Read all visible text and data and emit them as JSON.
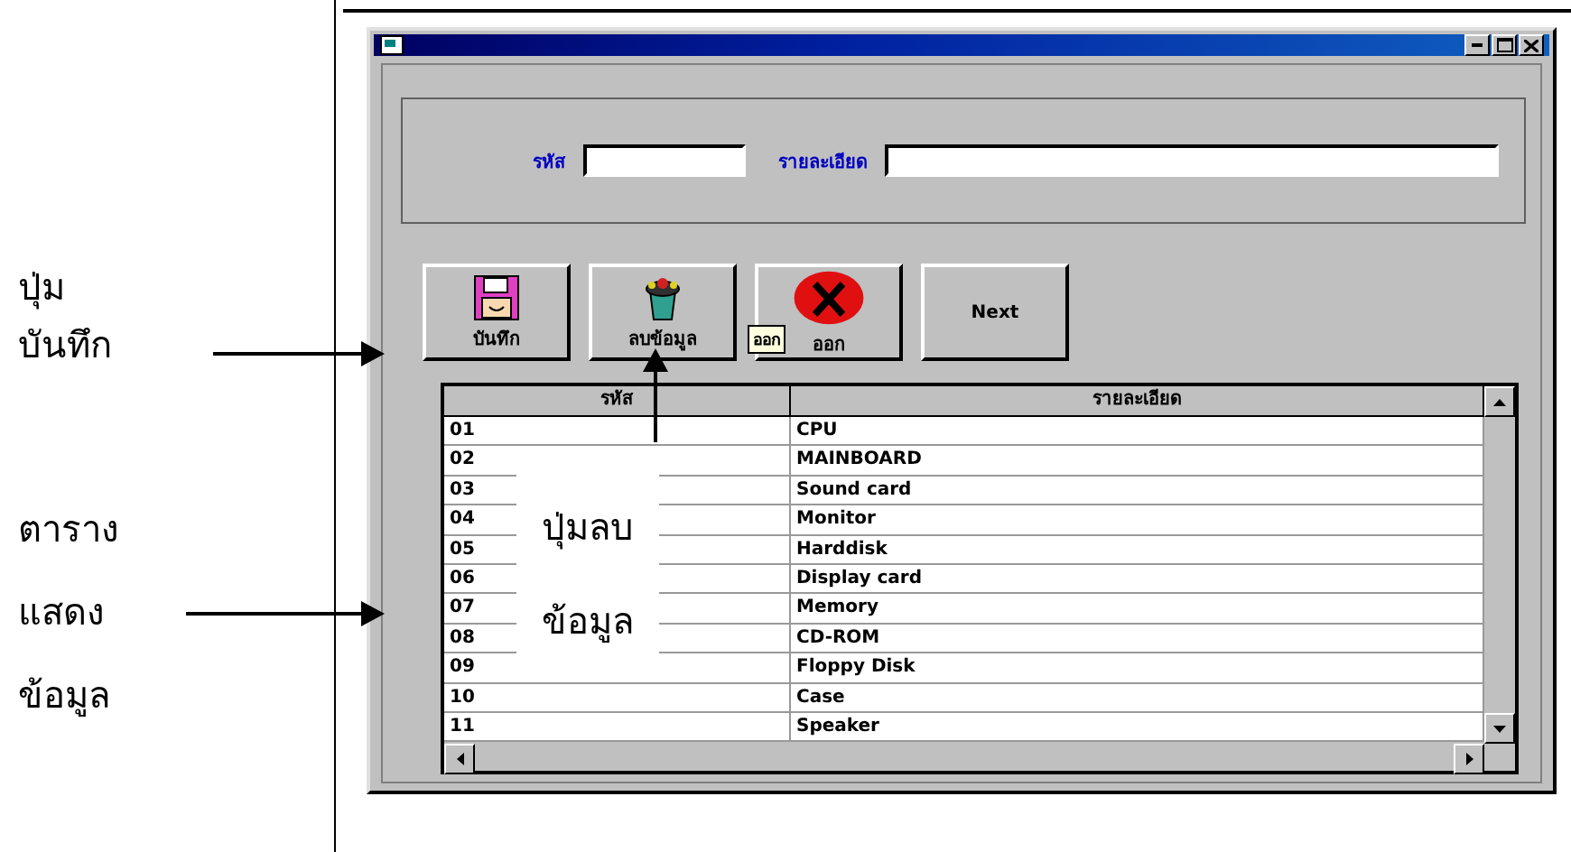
{
  "form": {
    "fields": [
      {
        "label": "รหัส"
      },
      {
        "label": "รายละเอียด"
      }
    ]
  },
  "toolbar": [
    {
      "kind": "save",
      "label": "บันทึก"
    },
    {
      "kind": "delete",
      "label": "ลบข้อมูล"
    },
    {
      "kind": "exit",
      "label": "ออก"
    },
    {
      "kind": "text",
      "label": "Next"
    }
  ],
  "tooltip": "ออก",
  "table": {
    "columns": [
      "รหัส",
      "รายละเอียด"
    ],
    "rows": [
      [
        "01",
        "CPU"
      ],
      [
        "02",
        "MAINBOARD"
      ],
      [
        "03",
        "Sound card"
      ],
      [
        "04",
        "Monitor"
      ],
      [
        "05",
        "Harddisk"
      ],
      [
        "06",
        "Display card"
      ],
      [
        "07",
        "Memory"
      ],
      [
        "08",
        "CD-ROM"
      ],
      [
        "09",
        "Floppy Disk"
      ],
      [
        "10",
        "Case"
      ],
      [
        "11",
        "Speaker"
      ]
    ]
  },
  "annotations": [
    {
      "lines": [
        "ปุ่ม",
        "บันทึก"
      ]
    },
    {
      "lines": [
        "ตาราง",
        "แสดง",
        "ข้อมูล"
      ]
    },
    {
      "lines": [
        "ปุ่มลบ",
        "ข้อมูล"
      ]
    }
  ]
}
